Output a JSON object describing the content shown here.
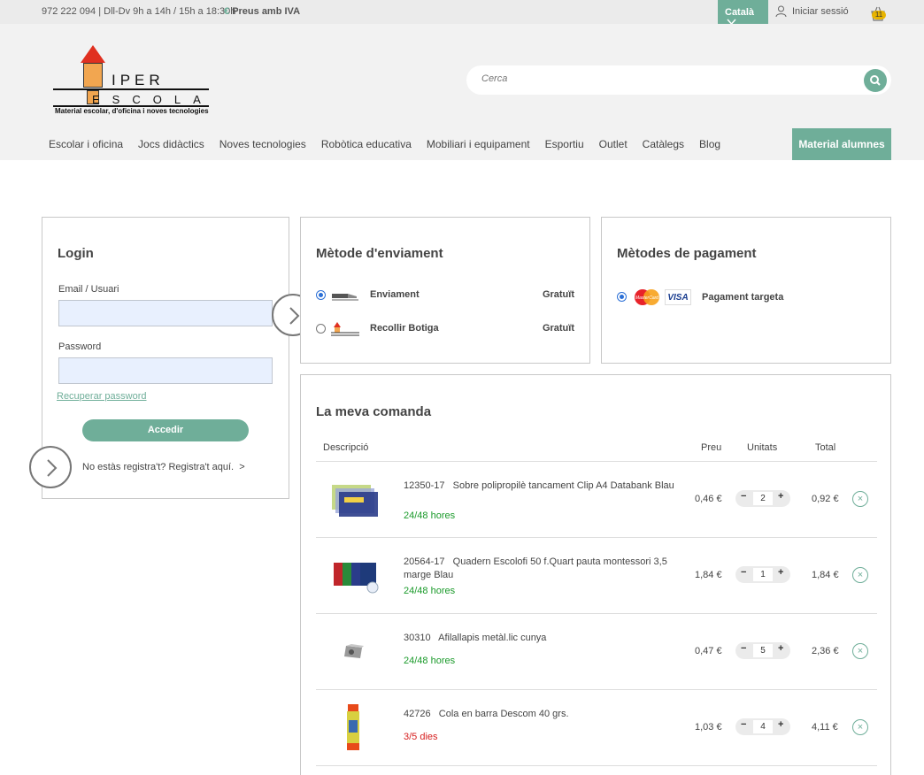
{
  "topbar": {
    "contact": "972 222 094 | Dll-Dv 9h a 14h / 15h a 18:30h",
    "euro_symbol": "€",
    "prices_note": "Preus amb IVA",
    "language": "Català",
    "login_link": "Iniciar sessió",
    "cart_count": "11"
  },
  "logo": {
    "word1": "IPER",
    "word2": "ESCOLA",
    "tagline": "Material escolar, d'oficina i noves tecnologies"
  },
  "search": {
    "placeholder": "Cerca"
  },
  "nav": {
    "items": [
      "Escolar i oficina",
      "Jocs didàctics",
      "Noves tecnologies",
      "Robòtica educativa",
      "Mobiliari i equipament",
      "Esportiu",
      "Outlet",
      "Catàlegs",
      "Blog"
    ],
    "material_button": "Material alumnes"
  },
  "login": {
    "title": "Login",
    "email_label": "Email / Usuari",
    "email_value": "",
    "password_label": "Password",
    "password_value": "",
    "recover_link": "Recuperar password",
    "submit": "Accedir",
    "register_link": "No estàs registra't? Registra't aquí.",
    "register_arrow": ">"
  },
  "shipping": {
    "title": "Mètode d'enviament",
    "options": [
      {
        "name": "Enviament",
        "price": "Gratuït",
        "selected": true
      },
      {
        "name": "Recollir Botiga",
        "price": "Gratuït",
        "selected": false
      }
    ]
  },
  "payment": {
    "title": "Mètodes de pagament",
    "card_brand_1": "MasterCard",
    "card_brand_2": "VISA",
    "option_name": "Pagament targeta"
  },
  "order": {
    "title": "La meva comanda",
    "columns": {
      "description": "Descripció",
      "price": "Preu",
      "units": "Unitats",
      "total": "Total"
    },
    "items": [
      {
        "ref": "12350-17",
        "name": "Sobre polipropilè tancament Clip A4 Databank Blau",
        "availability": "24/48 hores",
        "price": "0,46 €",
        "qty": "2",
        "total": "0,92 €"
      },
      {
        "ref": "20564-17",
        "name": "Quadern Escolofi 50 f.Quart pauta montessori 3,5 marge Blau",
        "availability": "24/48 hores",
        "price": "1,84 €",
        "qty": "1",
        "total": "1,84 €"
      },
      {
        "ref": "30310",
        "name": "Afilallapis metàl.lic cunya",
        "availability": "24/48 hores",
        "price": "0,47 €",
        "qty": "5",
        "total": "2,36 €"
      },
      {
        "ref": "42726",
        "name": "Cola en barra Descom 40 grs.",
        "availability": "3/5 dies",
        "price": "1,03 €",
        "qty": "4",
        "total": "4,11 €"
      }
    ],
    "minus_symbol": "−",
    "plus_symbol": "+",
    "remove_symbol": "×"
  },
  "colors": {
    "accent": "#6fae99",
    "available_fast": "#1a9a2a",
    "available_slow": "#d62020",
    "cart_badge": "#e8b400"
  },
  "icons": {
    "user": "user-icon",
    "cart": "basket-icon",
    "search": "magnifier-icon",
    "chevron": "chevron-down-icon",
    "step": "circle-chevron-right-icon"
  }
}
